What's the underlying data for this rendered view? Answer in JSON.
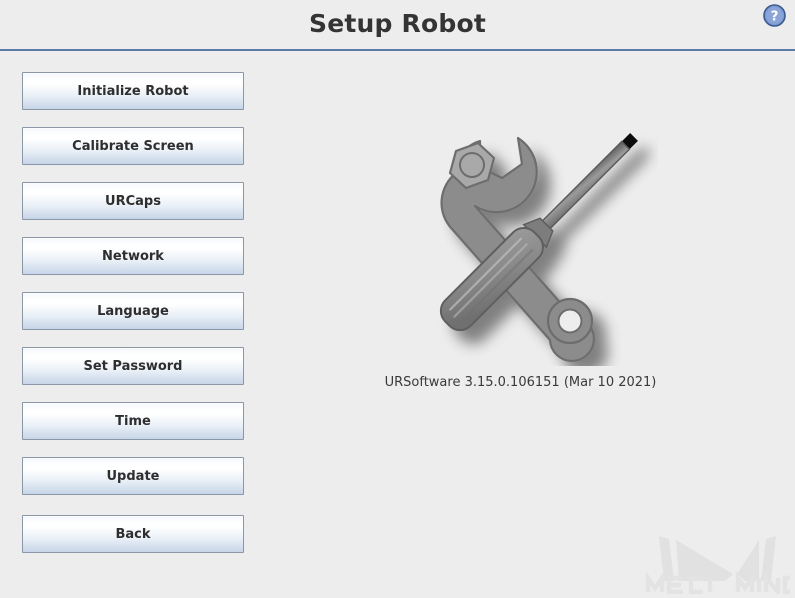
{
  "header": {
    "title": "Setup Robot",
    "help_icon": "help-question-icon",
    "help_label": "?",
    "divider_color": "#5b7ba6"
  },
  "sidebar": {
    "buttons": [
      {
        "label": "Initialize Robot",
        "name": "initialize-robot"
      },
      {
        "label": "Calibrate Screen",
        "name": "calibrate-screen"
      },
      {
        "label": "URCaps",
        "name": "urcaps"
      },
      {
        "label": "Network",
        "name": "network"
      },
      {
        "label": "Language",
        "name": "language"
      },
      {
        "label": "Set Password",
        "name": "set-password"
      },
      {
        "label": "Time",
        "name": "time"
      },
      {
        "label": "Update",
        "name": "update"
      },
      {
        "label": "Back",
        "name": "back"
      }
    ]
  },
  "main": {
    "illustration_icon": "wrench-and-screwdriver-icon",
    "version_text": "URSoftware 3.15.0.106151 (Mar 10 2021)"
  },
  "watermark": {
    "brand_text": "MECH MIND",
    "logo_icon": "mech-mind-camera-logo-icon",
    "color": "#e1e1e1"
  },
  "theme": {
    "background": "#ededed",
    "button_border": "#8b97a6",
    "title_color": "#343434",
    "accent_blue": "#5b7ba6",
    "tool_gray": "#8c8c8c"
  }
}
